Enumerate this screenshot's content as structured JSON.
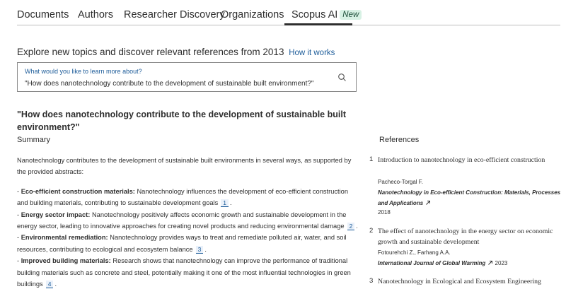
{
  "nav": {
    "tabs": [
      {
        "label": "Documents"
      },
      {
        "label": "Authors"
      },
      {
        "label": "Researcher Discovery"
      },
      {
        "label": "Organizations"
      },
      {
        "label": "Scopus AI",
        "badge": "New"
      }
    ]
  },
  "explore": {
    "text": "Explore new topics and discover relevant references from 2013",
    "link": "How it works"
  },
  "search": {
    "label": "What would you like to learn more about?",
    "value": "\"How does nanotechnology contribute to the development of sustainable built environment?\""
  },
  "question": "\"How does nanotechnology contribute to the development of sustainable built environment?\"",
  "summary": {
    "heading": "Summary",
    "intro": "Nanotechnology contributes to the development of sustainable built environments in several ways, as supported by the provided abstracts:",
    "points": [
      {
        "title": "Eco-efficient construction materials:",
        "text": "Nanotechnology influences the development of eco-efficient construction and building materials, contributing to sustainable development goals",
        "cite": "1"
      },
      {
        "title": "Energy sector impact:",
        "text": "Nanotechnology positively affects economic growth and sustainable development in the energy sector, leading to innovative approaches for creating novel products and reducing environmental damage",
        "cite": "2"
      },
      {
        "title": "Environmental remediation:",
        "text": "Nanotechnology provides ways to treat and remediate polluted air, water, and soil resources, contributing to ecological and ecosystem balance",
        "cite": "3"
      },
      {
        "title": "Improved building materials:",
        "text": "Research shows that nanotechnology can improve the performance of traditional building materials such as concrete and steel, potentially making it one of the most influential technologies in green buildings",
        "cite": "4"
      }
    ]
  },
  "references": {
    "heading": "References",
    "items": [
      {
        "num": "1",
        "title": "Introduction to nanotechnology in eco-efficient construction",
        "authors": "Pacheco-Torgal F.",
        "source": "Nanotechnology in Eco-efficient Construction: Materials, Processes and Applications",
        "year": "2018"
      },
      {
        "num": "2",
        "title": "The effect of nanotechnology in the energy sector on economic growth and sustainable development",
        "authors": "Fotourehchi Z., Farhang A.A.",
        "source": "International Journal of Global Warming",
        "year": "2023"
      },
      {
        "num": "3",
        "title": "Nanotechnology in Ecological and Ecosystem Engineering",
        "authors": "",
        "source": "",
        "year": ""
      }
    ]
  },
  "colors": {
    "link": "#1d5c99",
    "badge_bg": "#d7f1e4",
    "badge_text": "#1d4f3a",
    "text": "#2e2e2e"
  }
}
